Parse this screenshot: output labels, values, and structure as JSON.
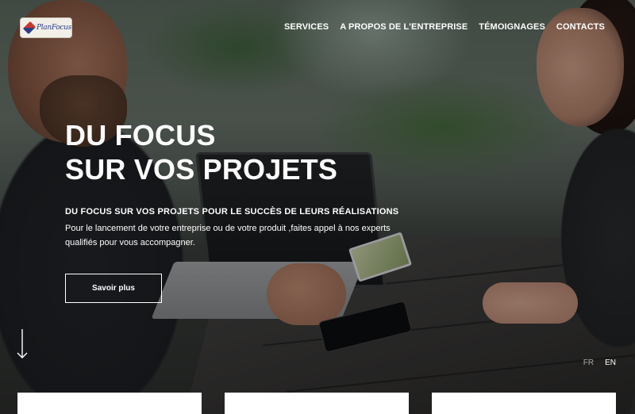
{
  "header": {
    "logo_text": "PlanFocus",
    "nav": [
      {
        "label": "SERVICES"
      },
      {
        "label": "A PROPOS DE L'ENTREPRISE"
      },
      {
        "label": "TÉMOIGNAGES"
      },
      {
        "label": "CONTACTS"
      }
    ]
  },
  "hero": {
    "title_line1": "DU FOCUS",
    "title_line2": "SUR VOS PROJETS",
    "subtitle": "DU FOCUS SUR VOS PROJETS POUR LE SUCCÈS DE LEURS RÉALISATIONS",
    "description": "Pour le lancement de votre entreprise ou de votre produit ,faites appel à nos experts qualifiés pour vous accompagner.",
    "cta_label": "Savoir plus"
  },
  "language_switcher": {
    "options": [
      {
        "label": "FR"
      },
      {
        "label": "EN"
      }
    ]
  },
  "icons": {
    "scroll": "arrow-down-icon",
    "logo": "planfocus-logo"
  },
  "colors": {
    "text": "#ffffff",
    "inactive_lang": "#a9a9a9",
    "card_bg": "#ffffff",
    "logo_red": "#c8372d",
    "logo_blue": "#2c3d87"
  }
}
